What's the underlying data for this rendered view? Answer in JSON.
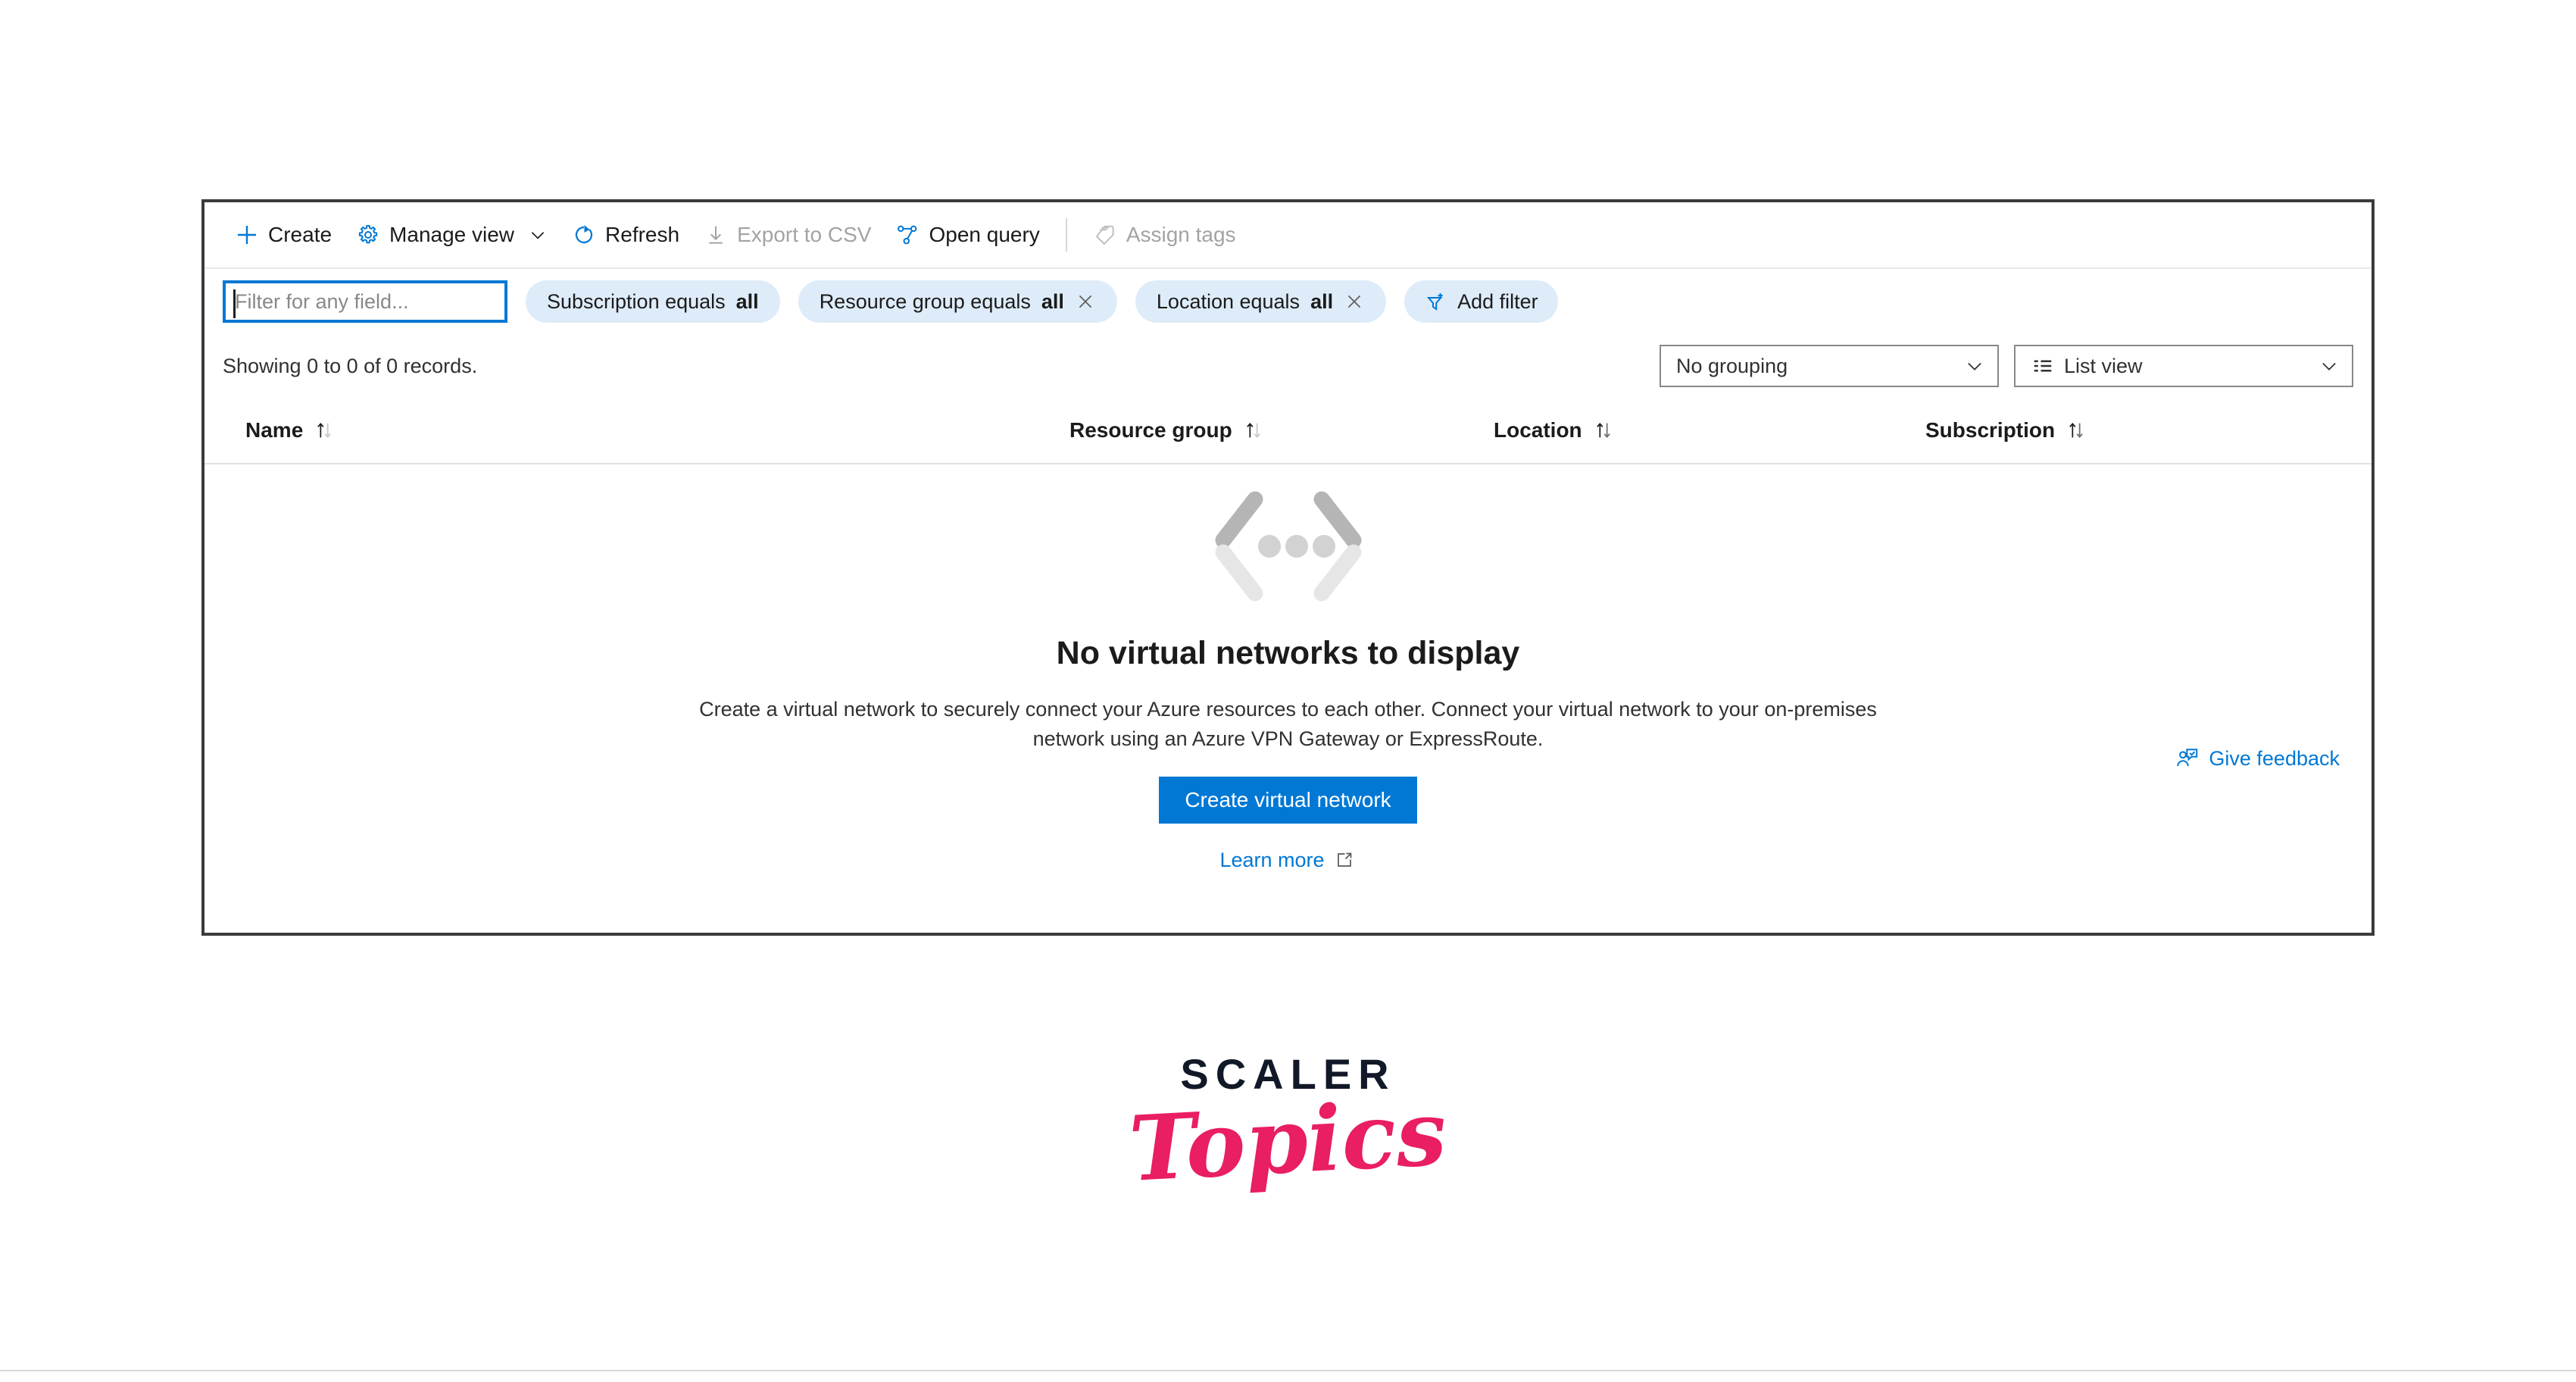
{
  "toolbar": {
    "items": [
      {
        "label": "Create",
        "icon": "plus-icon",
        "disabled": false
      },
      {
        "label": "Manage view",
        "icon": "gear-icon",
        "disabled": false,
        "chevron": true
      },
      {
        "label": "Refresh",
        "icon": "refresh-icon",
        "disabled": false
      },
      {
        "label": "Export to CSV",
        "icon": "download-icon",
        "disabled": true
      },
      {
        "label": "Open query",
        "icon": "query-graph-icon",
        "disabled": false
      },
      {
        "label": "Assign tags",
        "icon": "tags-icon",
        "disabled": true
      }
    ]
  },
  "filters": {
    "search": {
      "placeholder": "Filter for any field...",
      "value": ""
    },
    "pills": [
      {
        "prefix": "Subscription equals",
        "value": "all",
        "removable": false
      },
      {
        "prefix": "Resource group equals",
        "value": "all",
        "removable": true
      },
      {
        "prefix": "Location equals",
        "value": "all",
        "removable": true
      }
    ],
    "add_filter_label": "Add filter"
  },
  "summary": {
    "records_text": "Showing 0 to 0 of 0 records.",
    "grouping_value": "No grouping",
    "view_value": "List view"
  },
  "table": {
    "columns": [
      {
        "label": "Name"
      },
      {
        "label": "Resource group"
      },
      {
        "label": "Location"
      },
      {
        "label": "Subscription"
      }
    ],
    "rows": []
  },
  "empty_state": {
    "title": "No virtual networks to display",
    "description": "Create a virtual network to securely connect your Azure resources to each other. Connect your virtual network to your on-premises network using an Azure VPN Gateway or ExpressRoute.",
    "primary_button": "Create virtual network",
    "learn_more": "Learn more"
  },
  "feedback": {
    "label": "Give feedback"
  },
  "branding": {
    "wordmark": "SCALER",
    "script": "Topics"
  },
  "colors": {
    "accent": "#0078d4",
    "pill_bg": "#deecf9",
    "panel_border": "#3b3b3b",
    "disabled_text": "#a3a3a3",
    "brand_navy": "#111827",
    "brand_pink": "#e91e63"
  }
}
